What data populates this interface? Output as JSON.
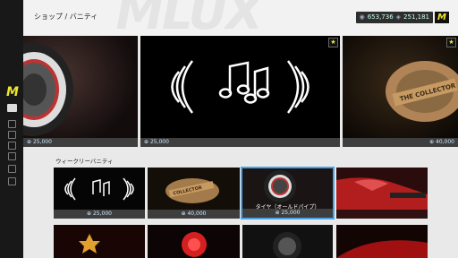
{
  "header": {
    "title": "ショップ / バニティ",
    "background_watermark": "MLUX",
    "currency_a": "653,736",
    "currency_b": "251,181",
    "logo": "M"
  },
  "sidebar": {
    "logo": "M"
  },
  "featured": [
    {
      "name": "tire-card",
      "price": "25,000"
    },
    {
      "name": "music-horn-card",
      "price": "25,000"
    },
    {
      "name": "collector-emblem-card",
      "price": "40,000"
    }
  ],
  "weekly": {
    "title": "ウィークリーバニティ",
    "items": [
      {
        "price": "25,000"
      },
      {
        "price": "40,000"
      },
      {
        "price": "25,000",
        "label": "タイヤ（オールドパイプ）"
      },
      {
        "price": ""
      }
    ]
  },
  "colors": {
    "accent": "#f0e52e",
    "selection": "#4aa3e8",
    "price_bar": "#3e3e3e"
  }
}
